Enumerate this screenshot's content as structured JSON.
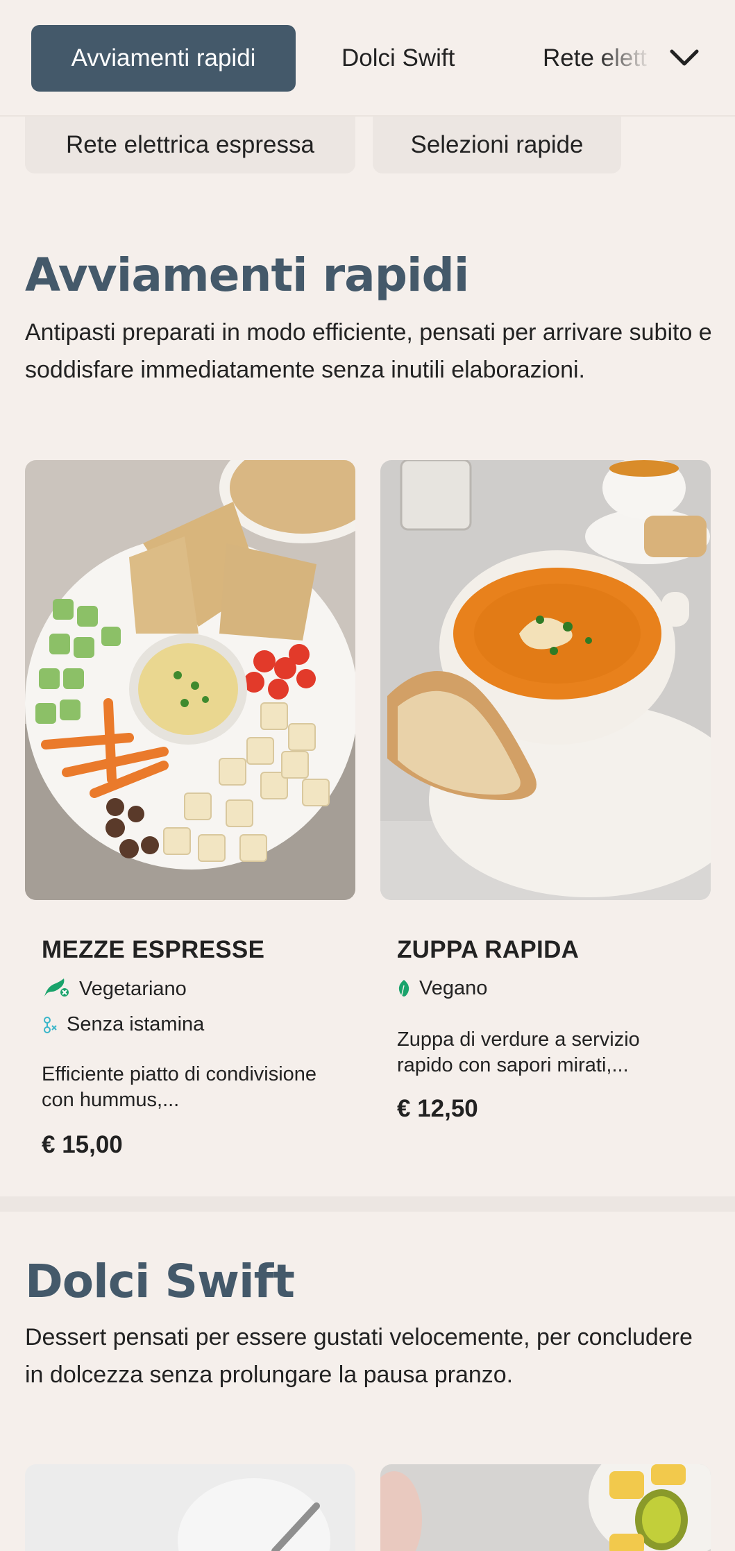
{
  "nav": {
    "tabs": [
      {
        "label": "Avviamenti rapidi",
        "active": true
      },
      {
        "label": "Dolci Swift",
        "active": false
      },
      {
        "label": "Rete elettrica espressa",
        "active": false
      }
    ],
    "chips": [
      "Rete elettrica espressa",
      "Selezioni rapide"
    ],
    "expand_icon": "chevron-down-icon",
    "active_color": "#44596a"
  },
  "sections": [
    {
      "title": "Avviamenti rapidi",
      "description": "Antipasti preparati in modo efficiente, pensati per arrivare subito e soddisfare immediatamente senza inutili elaborazioni.",
      "items": [
        {
          "name": "MEZZE ESPRESSE",
          "tags": [
            {
              "label": "Vegetariano",
              "icon": "vegetarian-icon",
              "color": "#1aa36b"
            },
            {
              "label": "Senza istamina",
              "icon": "histamine-free-icon",
              "color": "#3bb6c9"
            }
          ],
          "description": "Efficiente piatto di condivisione con hummus,...",
          "price": "€ 15,00"
        },
        {
          "name": "ZUPPA RAPIDA",
          "tags": [
            {
              "label": "Vegano",
              "icon": "vegan-leaf-icon",
              "color": "#1aa36b"
            }
          ],
          "description": "Zuppa di verdure a servizio rapido con sapori mirati,...",
          "price": "€ 12,50"
        }
      ]
    },
    {
      "title": "Dolci Swift",
      "description": "Dessert pensati per essere gustati velocemente, per concludere in dolcezza senza prolungare la pausa pranzo."
    }
  ]
}
